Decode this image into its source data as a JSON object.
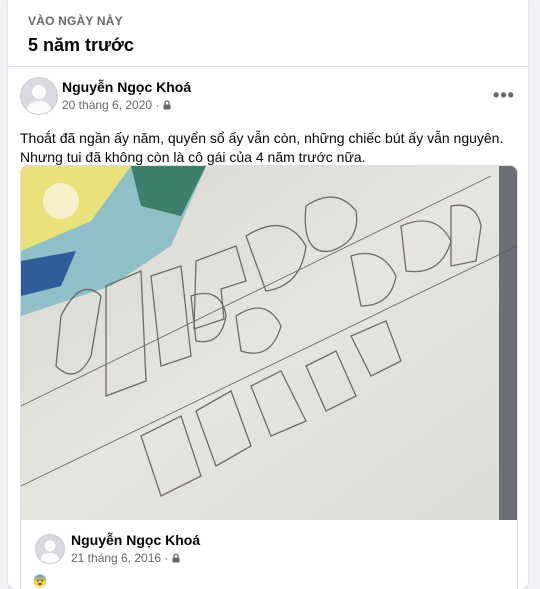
{
  "memories": {
    "label": "VÀO NGÀY NÀY",
    "title": "5 năm trước"
  },
  "post": {
    "author": "Nguyễn Ngọc Khoá",
    "date": "20 tháng 6, 2020 ·",
    "privacy_icon": "lock-icon",
    "more_icon": "more-options-icon",
    "text": "Thoắt đã ngần ấy năm, quyển sổ ấy vẫn còn, những chiếc bút ấy vẫn nguyên. Nhưng tui đã không còn là cô gái của 4 năm trước nữa."
  },
  "shared_post": {
    "author": "Nguyễn Ngọc Khoá",
    "date": "21 tháng 6, 2016 ·",
    "privacy_icon": "lock-icon",
    "emoji_icon": "anxious-face-emoji",
    "photo_description_icon": "sketchbook-photo"
  },
  "colors": {
    "secondary_text": "#65676b",
    "divider": "#dadde1",
    "background": "#f0f2f5"
  }
}
